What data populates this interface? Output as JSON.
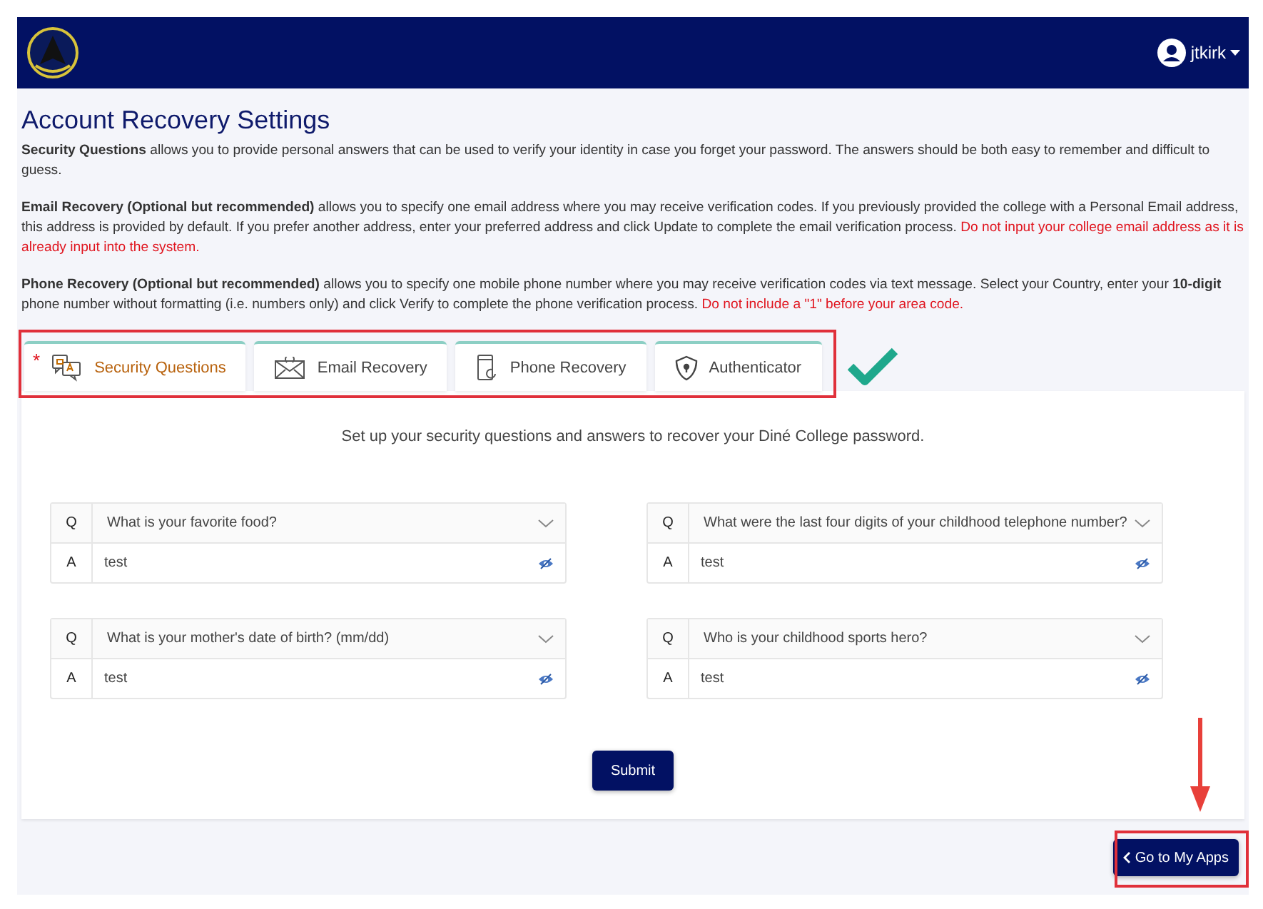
{
  "header": {
    "user": "jtkirk"
  },
  "title": "Account Recovery Settings",
  "paragraphs": [
    {
      "segments": [
        {
          "kind": "bold",
          "text": "Security Questions"
        },
        {
          "kind": "normal",
          "text": " allows you to provide personal answers that can be used to verify your identity in case you forget your password. The answers should be both easy to remember and difficult to guess."
        }
      ]
    },
    {
      "segments": [
        {
          "kind": "bold",
          "text": "Email Recovery (Optional but recommended)"
        },
        {
          "kind": "normal",
          "text": " allows you to specify one email address where you may receive verification codes. If you previously provided the college with a Personal Email address, this address is provided by default. If you prefer another address, enter your preferred address and click Update to complete the email verification process. "
        },
        {
          "kind": "warning",
          "text": "Do not input your college email address as it is already input into the system."
        }
      ]
    },
    {
      "segments": [
        {
          "kind": "bold",
          "text": "Phone Recovery (Optional but recommended)"
        },
        {
          "kind": "normal",
          "text": " allows you to specify one mobile phone number where you may receive verification codes via text message. Select your Country, enter your "
        },
        {
          "kind": "bold",
          "text": "10-digit"
        },
        {
          "kind": "normal",
          "text": " phone number without formatting (i.e. numbers only) and click Verify to complete the phone verification process. "
        },
        {
          "kind": "warning",
          "text": "Do not include a \"1\" before your area code."
        }
      ]
    }
  ],
  "tabs": [
    {
      "label": "Security Questions",
      "selected": true,
      "kind": "qa",
      "marker": "*"
    },
    {
      "label": "Email Recovery",
      "selected": false,
      "kind": "mail"
    },
    {
      "label": "Phone Recovery",
      "selected": false,
      "kind": "phone"
    },
    {
      "label": "Authenticator",
      "selected": false,
      "kind": "shield"
    }
  ],
  "intro": "Set up your security questions and answers to recover your Diné College password.",
  "questions": [
    {
      "q_marker": "Q",
      "question": "What is your favorite food?",
      "a_marker": "A",
      "answer": "test"
    },
    {
      "q_marker": "Q",
      "question": "What were the last four digits of your childhood telephone number?",
      "a_marker": "A",
      "answer": "test"
    },
    {
      "q_marker": "Q",
      "question": "What is your mother's date of birth? (mm/dd)",
      "a_marker": "A",
      "answer": "test"
    },
    {
      "q_marker": "Q",
      "question": "Who is your childhood sports hero?",
      "a_marker": "A",
      "answer": "test"
    }
  ],
  "submit": "Submit",
  "back_button": "Go to My Apps"
}
